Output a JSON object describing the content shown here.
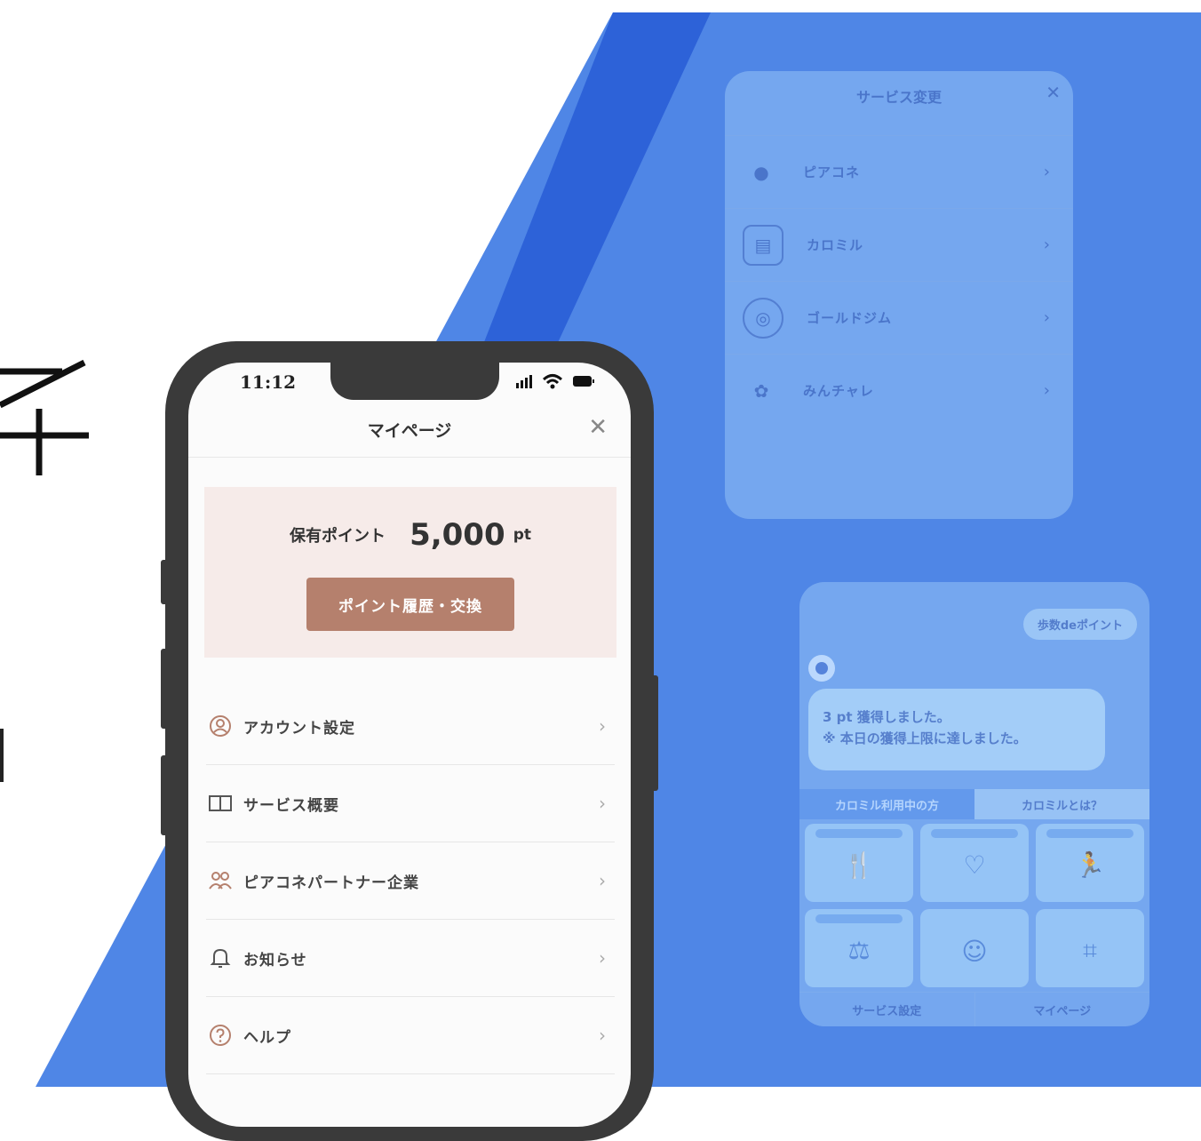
{
  "colors": {
    "bg_blue": "#4f86e6",
    "bg_dark_blue": "#2d62d8",
    "accent_brown": "#b5806d",
    "card_pink": "#f6ebe9"
  },
  "phone": {
    "status_time": "11:12",
    "nav_title": "マイページ",
    "points_label": "保有ポイント",
    "points_value": "5,000",
    "points_unit": "pt",
    "points_button": "ポイント履歴・交換",
    "menu": [
      {
        "label": "アカウント設定",
        "icon": "user-circle-icon"
      },
      {
        "label": "サービス概要",
        "icon": "book-icon"
      },
      {
        "label": "ピアコネパートナー企業",
        "icon": "people-icon"
      },
      {
        "label": "お知らせ",
        "icon": "bell-icon"
      },
      {
        "label": "ヘルプ",
        "icon": "question-icon"
      }
    ]
  },
  "service_panel": {
    "title": "サービス変更",
    "items": [
      {
        "label": "ピアコネ"
      },
      {
        "label": "カロミル"
      },
      {
        "label": "ゴールドジム"
      },
      {
        "label": "みんチャレ"
      }
    ]
  },
  "calomiru_panel": {
    "pill": "歩数deポイント",
    "message_line1": "3 pt 獲得しました。",
    "message_line2": "※ 本日の獲得上限に達しました。",
    "tab_active": "カロミル利用中の方",
    "tab_inactive": "カロミルとは？",
    "bottom_left": "サービス設定",
    "bottom_right": "マイページ"
  }
}
